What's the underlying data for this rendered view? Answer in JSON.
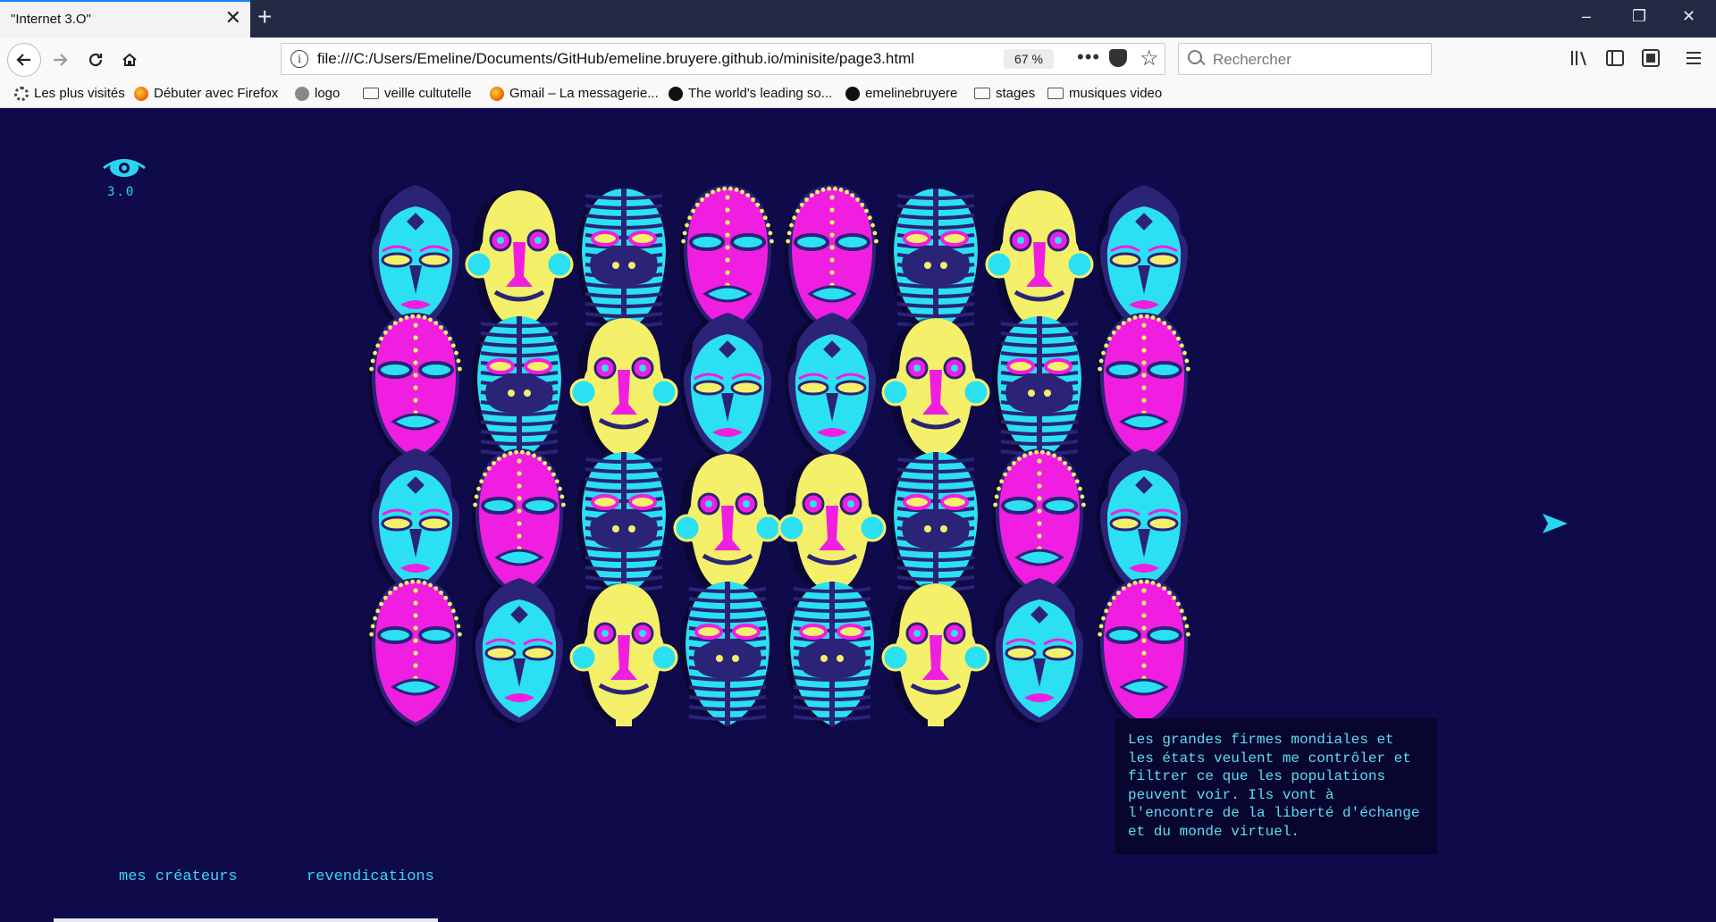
{
  "browser": {
    "tab_title": "\"Internet 3.O\"",
    "tab_close": "✕",
    "new_tab": "+",
    "window_controls": {
      "minimize": "–",
      "restore": "❐",
      "close": "✕"
    },
    "url": "file:///C:/Users/Emeline/Documents/GitHub/emeline.bruyere.github.io/minisite/page3.html",
    "zoom": "67 %",
    "page_actions": "•••",
    "search_placeholder": "Rechercher",
    "bookmarks": [
      {
        "label": "Les plus visités",
        "icon": "gear-icon"
      },
      {
        "label": "Débuter avec Firefox",
        "icon": "firefox-icon"
      },
      {
        "label": "logo",
        "icon": "globe-icon"
      },
      {
        "label": "veille cultutelle",
        "icon": "folder-icon"
      },
      {
        "label": "Gmail – La messagerie...",
        "icon": "firefox-icon"
      },
      {
        "label": "The world's leading so...",
        "icon": "github-icon"
      },
      {
        "label": "emelinebruyere",
        "icon": "github-icon"
      },
      {
        "label": "stages",
        "icon": "folder-icon"
      },
      {
        "label": "musiques video",
        "icon": "folder-icon"
      }
    ]
  },
  "page": {
    "logo_text": "3.0",
    "info_text": "Les grandes firmes mondiales et les états veulent me contrôler et filtrer ce que les populations peuvent voir. Ils vont à l'encontre de la liberté d'échange et du monde virtuel.",
    "links": {
      "creators": "mes créateurs",
      "claims": "revendications"
    },
    "mask_rows": [
      [
        "blue",
        "yellow",
        "striped",
        "pink",
        "pink",
        "striped",
        "yellow",
        "blue"
      ],
      [
        "pink",
        "striped",
        "yellow",
        "blue",
        "blue",
        "yellow",
        "striped",
        "pink"
      ],
      [
        "blue",
        "pink",
        "striped",
        "yellow",
        "yellow",
        "striped",
        "pink",
        "blue"
      ],
      [
        "pink",
        "blue",
        "yellow",
        "striped",
        "striped",
        "yellow",
        "blue",
        "pink"
      ]
    ],
    "colors": {
      "background": "#0f0a4a",
      "accent": "#29d6f1",
      "pink": "#f01ee0",
      "yellow": "#f4f06a",
      "cyan": "#2be0f2",
      "dark": "#2a2377"
    }
  }
}
